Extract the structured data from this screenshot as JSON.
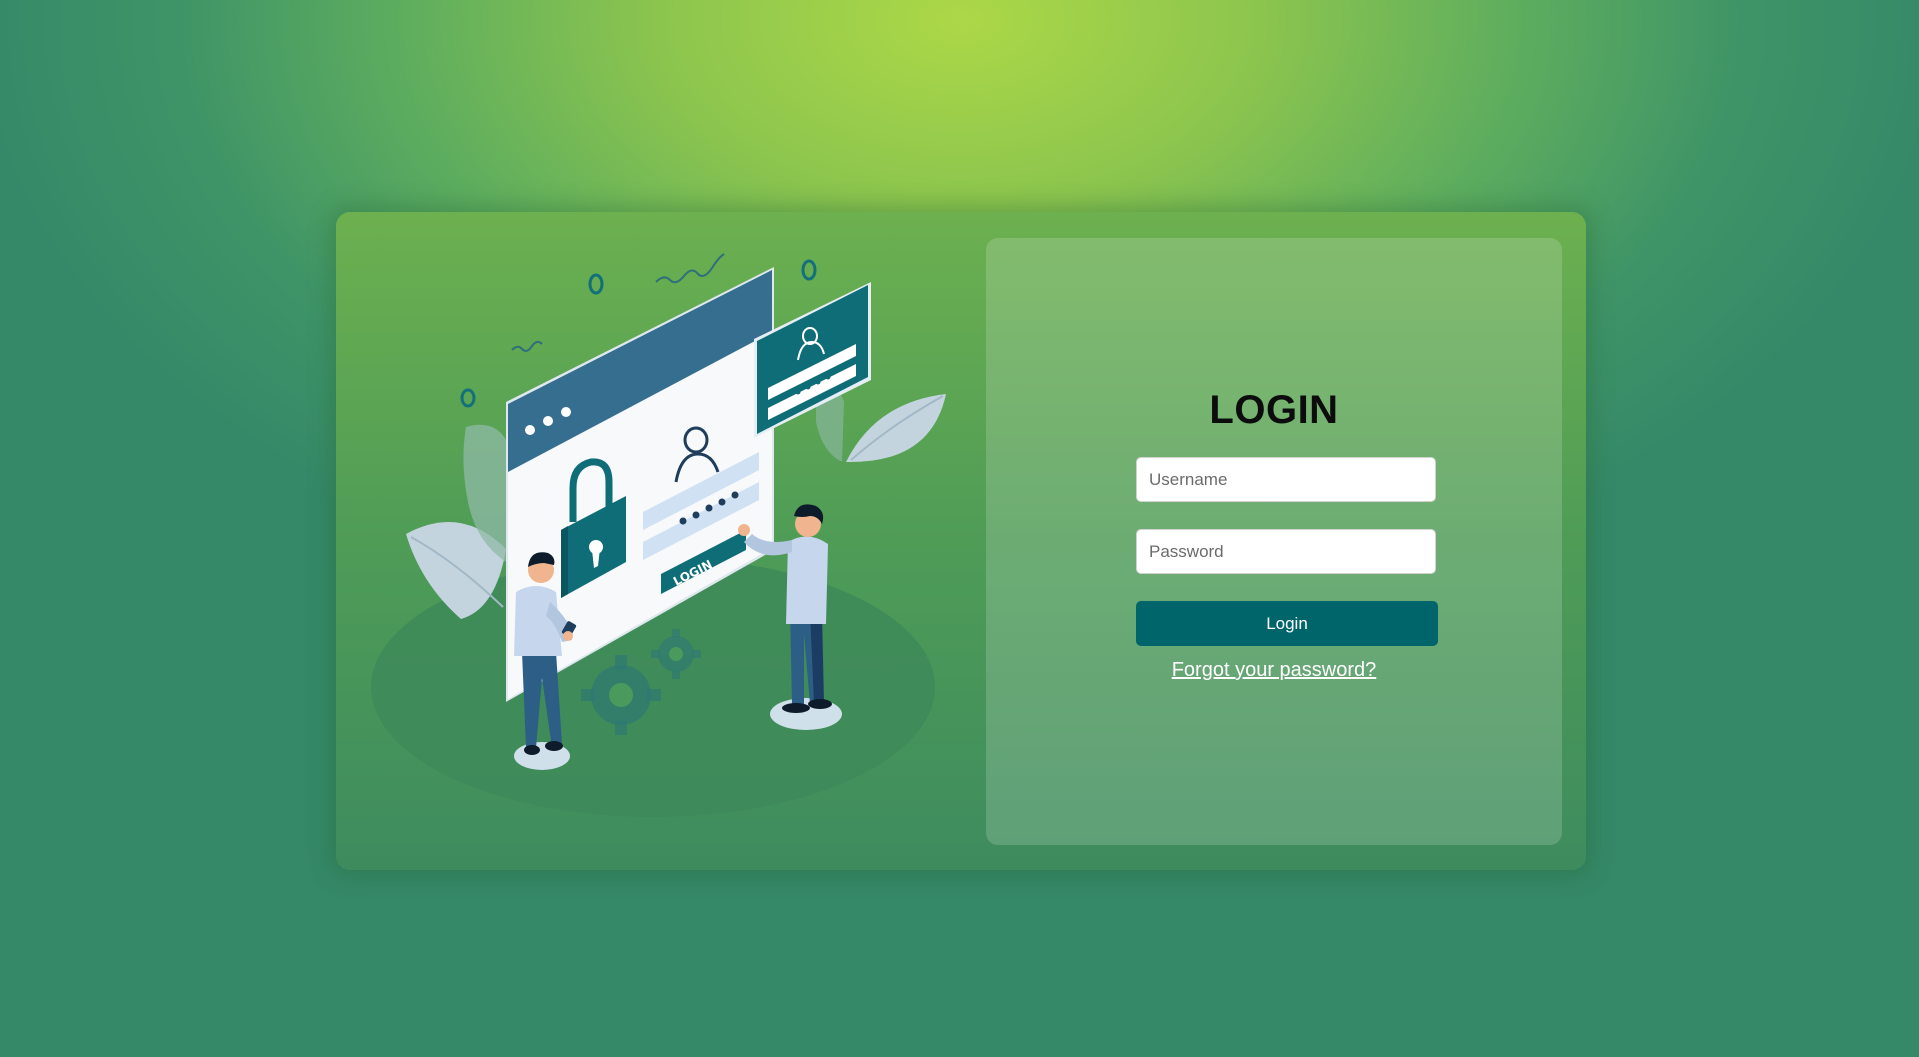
{
  "login": {
    "title": "LOGIN",
    "username_placeholder": "Username",
    "password_placeholder": "Password",
    "button_label": "Login",
    "forgot_link": "Forgot your password?"
  },
  "illustration": {
    "button_text": "LOGIN"
  },
  "colors": {
    "accent": "#00656b",
    "card_background": "#5ea857",
    "page_highlight": "#acd847"
  },
  "icons": [
    "lock-icon",
    "user-icon",
    "gear-icon",
    "browser-window",
    "person"
  ]
}
